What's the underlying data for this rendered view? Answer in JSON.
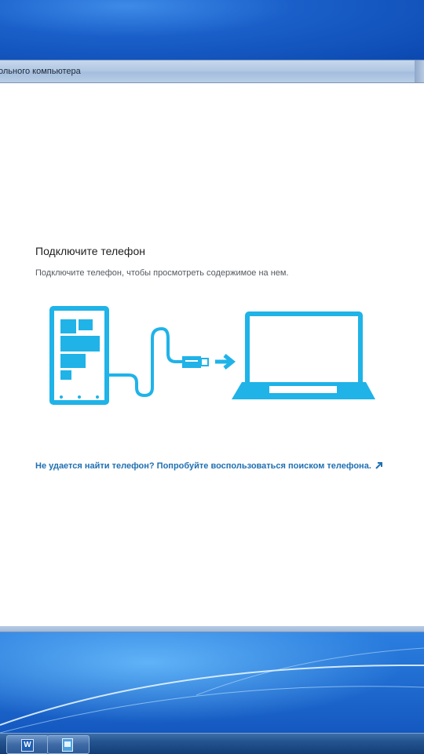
{
  "window": {
    "title": "ольного компьютера"
  },
  "content": {
    "heading": "Подключите телефон",
    "subtext": "Подключите телефон, чтобы просмотреть содержимое на нем.",
    "help_link": "Не удается найти телефон? Попробуйте воспользоваться поиском телефона."
  },
  "colors": {
    "accent": "#1fb3e8",
    "link": "#1f6fb2"
  },
  "taskbar": {
    "items": [
      {
        "name": "word-icon",
        "label": "W"
      },
      {
        "name": "document-icon",
        "label": ""
      }
    ]
  }
}
